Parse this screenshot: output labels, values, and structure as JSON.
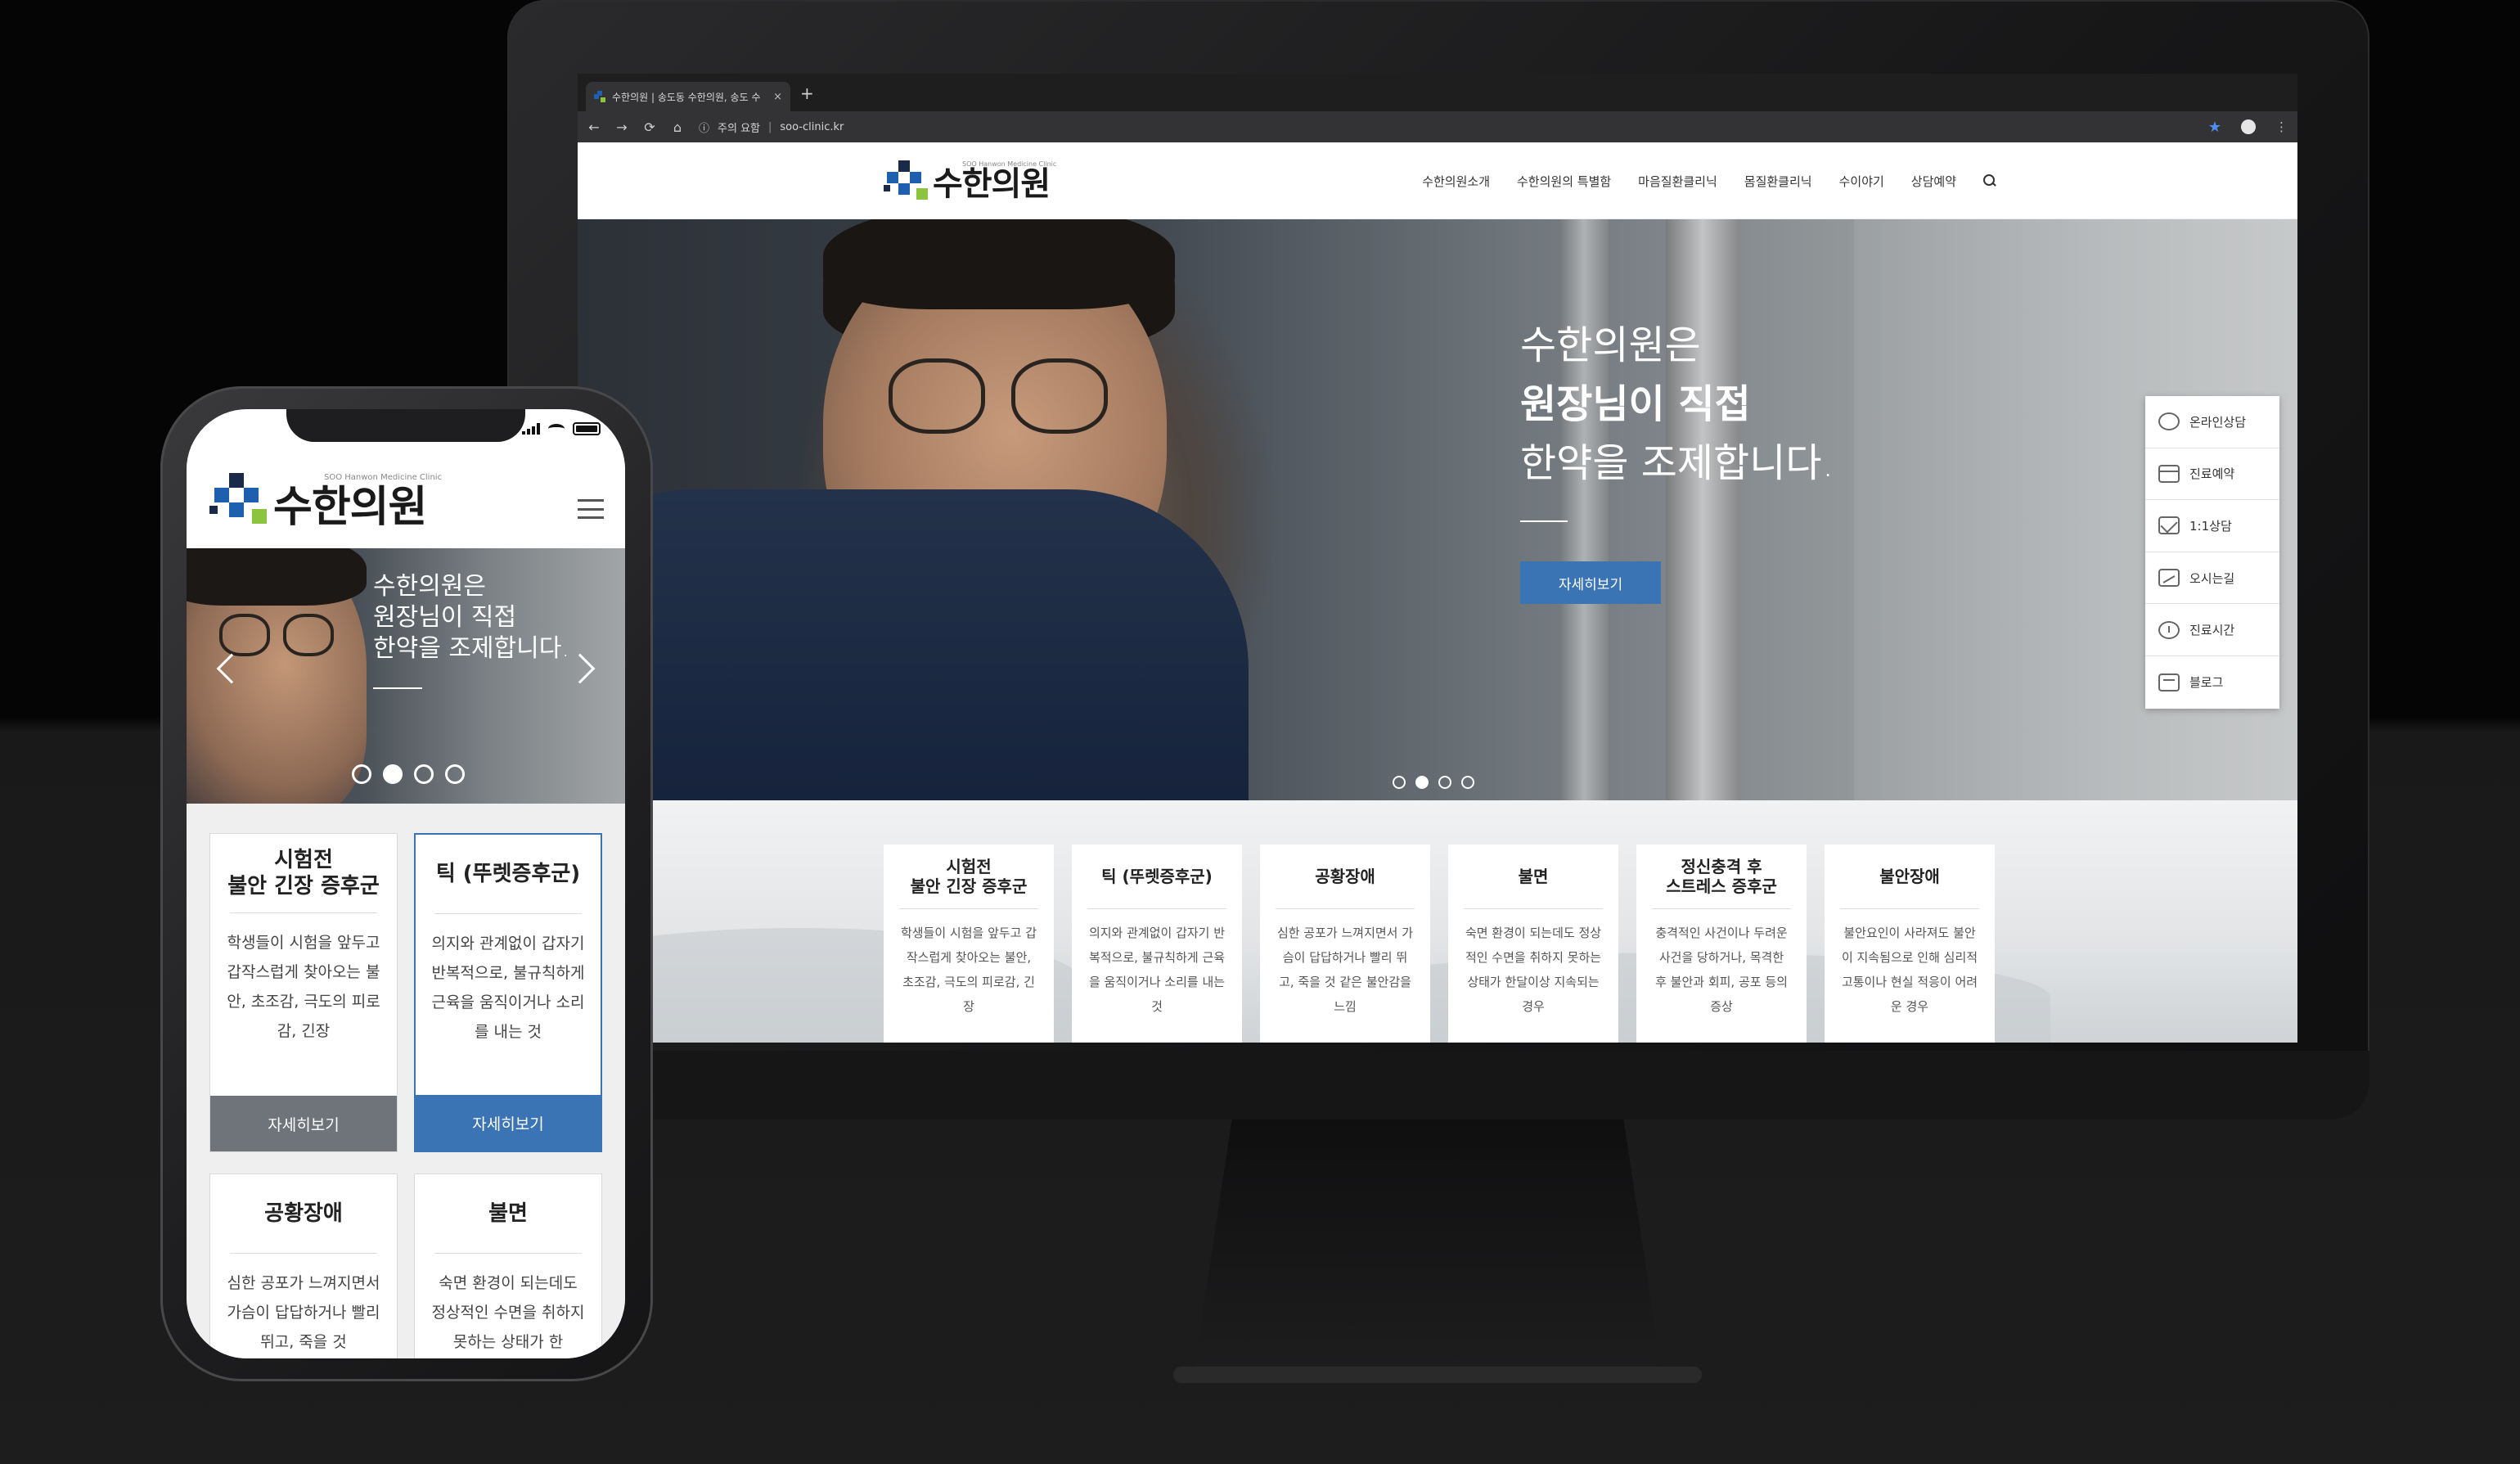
{
  "colors": {
    "brand_blue": "#3a74b4",
    "logo_blue": "#1f5fb0",
    "logo_green": "#8bc53f",
    "logo_dark": "#1c2a4a"
  },
  "browser": {
    "tab_title": "수한의원 | 송도동 수한의원, 송도 수",
    "tab_close": "×",
    "new_tab": "+",
    "nav_back": "←",
    "nav_forward": "→",
    "nav_reload": "⟳",
    "nav_home": "⌂",
    "security_info": "ⓘ",
    "security_label": "주의 요함",
    "url_sep": "|",
    "url": "soo-clinic.kr",
    "bookmark": "★",
    "menu": "⋮"
  },
  "site": {
    "logo_text": "수한의원",
    "logo_en": "SOO Hanwon Medicine Clinic",
    "nav": [
      "수한의원소개",
      "수한의원의 특별함",
      "마음질환클리닉",
      "몸질환클리닉",
      "수이야기",
      "상담예약"
    ],
    "hero": {
      "line1": "수한의원은",
      "line2": "원장님이 직접",
      "line3": "한약을 조제합니다.",
      "button": "자세히보기"
    },
    "quick_menu": [
      {
        "label": "온라인상담",
        "icon": "chat-icon"
      },
      {
        "label": "진료예약",
        "icon": "calendar-icon"
      },
      {
        "label": "1:1상담",
        "icon": "mail-icon"
      },
      {
        "label": "오시는길",
        "icon": "map-icon"
      },
      {
        "label": "진료시간",
        "icon": "clock-icon"
      },
      {
        "label": "블로그",
        "icon": "blog-icon"
      }
    ],
    "cards": [
      {
        "title": "시험전\n불안 긴장 증후군",
        "desc": "학생들이 시험을 앞두고 갑작스럽게 찾아오는 불안, 초조감, 극도의 피로감, 긴장"
      },
      {
        "title": "틱 (뚜렛증후군)",
        "desc": "의지와 관계없이 갑자기 반복적으로, 불규칙하게 근육을 움직이거나 소리를 내는 것"
      },
      {
        "title": "공황장애",
        "desc": "심한 공포가 느껴지면서 가슴이 답답하거나 빨리 뛰고, 죽을 것 같은 불안감을 느낌"
      },
      {
        "title": "불면",
        "desc": "숙면 환경이 되는데도 정상적인 수면을 취하지 못하는 상태가 한달이상 지속되는 경우"
      },
      {
        "title": "정신충격 후\n스트레스 증후군",
        "desc": "충격적인 사건이나 두려운 사건을 당하거나, 목격한 후 불안과 회피, 공포 등의 증상"
      },
      {
        "title": "불안장애",
        "desc": "불안요인이 사라져도 불안이 지속됨으로 인해 심리적 고통이나 현실 적응이 어려운 경우"
      }
    ]
  },
  "mobile": {
    "hero": {
      "line1": "수한의원은",
      "line2": "원장님이 직접",
      "line3": "한약을 조제합니다."
    },
    "cards": [
      {
        "title": "시험전\n불안 긴장 증후군",
        "desc": "학생들이 시험을 앞두고 갑작스럽게 찾아오는 불안, 초조감, 극도의 피로감, 긴장",
        "button": "자세히보기"
      },
      {
        "title": "틱 (뚜렛증후군)",
        "desc": "의지와 관계없이 갑자기 반복적으로, 불규칙하게 근육을 움직이거나 소리를 내는 것",
        "button": "자세히보기"
      },
      {
        "title": "공황장애",
        "desc": "심한 공포가 느껴지면서 가슴이 답답하거나 빨리 뛰고, 죽을 것"
      },
      {
        "title": "불면",
        "desc": "숙면 환경이 되는데도 정상적인 수면을 취하지 못하는 상태가 한"
      }
    ]
  },
  "slider": {
    "total_slides": 4,
    "active_slide": 2
  }
}
